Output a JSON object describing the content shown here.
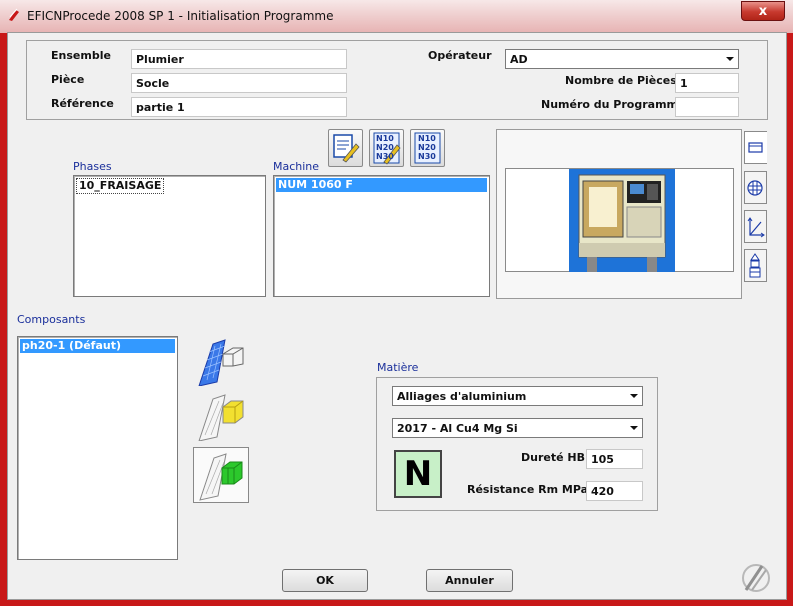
{
  "window": {
    "title": "EFICNProcede 2008 SP 1 - Initialisation Programme",
    "close_glyph": "x"
  },
  "header": {
    "ensemble_label": "Ensemble",
    "ensemble_value": "Plumier",
    "piece_label": "Pièce",
    "piece_value": "Socle",
    "reference_label": "Référence",
    "reference_value": "partie 1",
    "operateur_label": "Opérateur",
    "operateur_value": "AD",
    "nb_pieces_label": "Nombre de Pièces",
    "nb_pieces_value": "1",
    "num_programme_label": "Numéro du Programme",
    "num_programme_value": ""
  },
  "toolbar": {
    "nc_lines": [
      "N10",
      "N20",
      "N30"
    ]
  },
  "phases": {
    "label": "Phases",
    "items": [
      "10_FRAISAGE"
    ]
  },
  "machine": {
    "label": "Machine",
    "items": [
      "NUM 1060 F"
    ]
  },
  "composants": {
    "label": "Composants",
    "items": [
      "ph20-1 (Défaut)"
    ]
  },
  "matiere": {
    "label": "Matière",
    "famille": "Alliages d'aluminium",
    "nuance": "2017 - Al Cu4 Mg Si",
    "grade_letter": "N",
    "durete_label": "Dureté HB",
    "durete_value": "105",
    "resistance_label": "Résistance Rm MPa",
    "resistance_value": "420"
  },
  "buttons": {
    "ok": "OK",
    "annuler": "Annuler"
  },
  "colors": {
    "frame_red": "#c81818",
    "selection_blue": "#3399ff",
    "label_blue": "#1a2f9b",
    "grade_green": "#c8f0c8"
  }
}
